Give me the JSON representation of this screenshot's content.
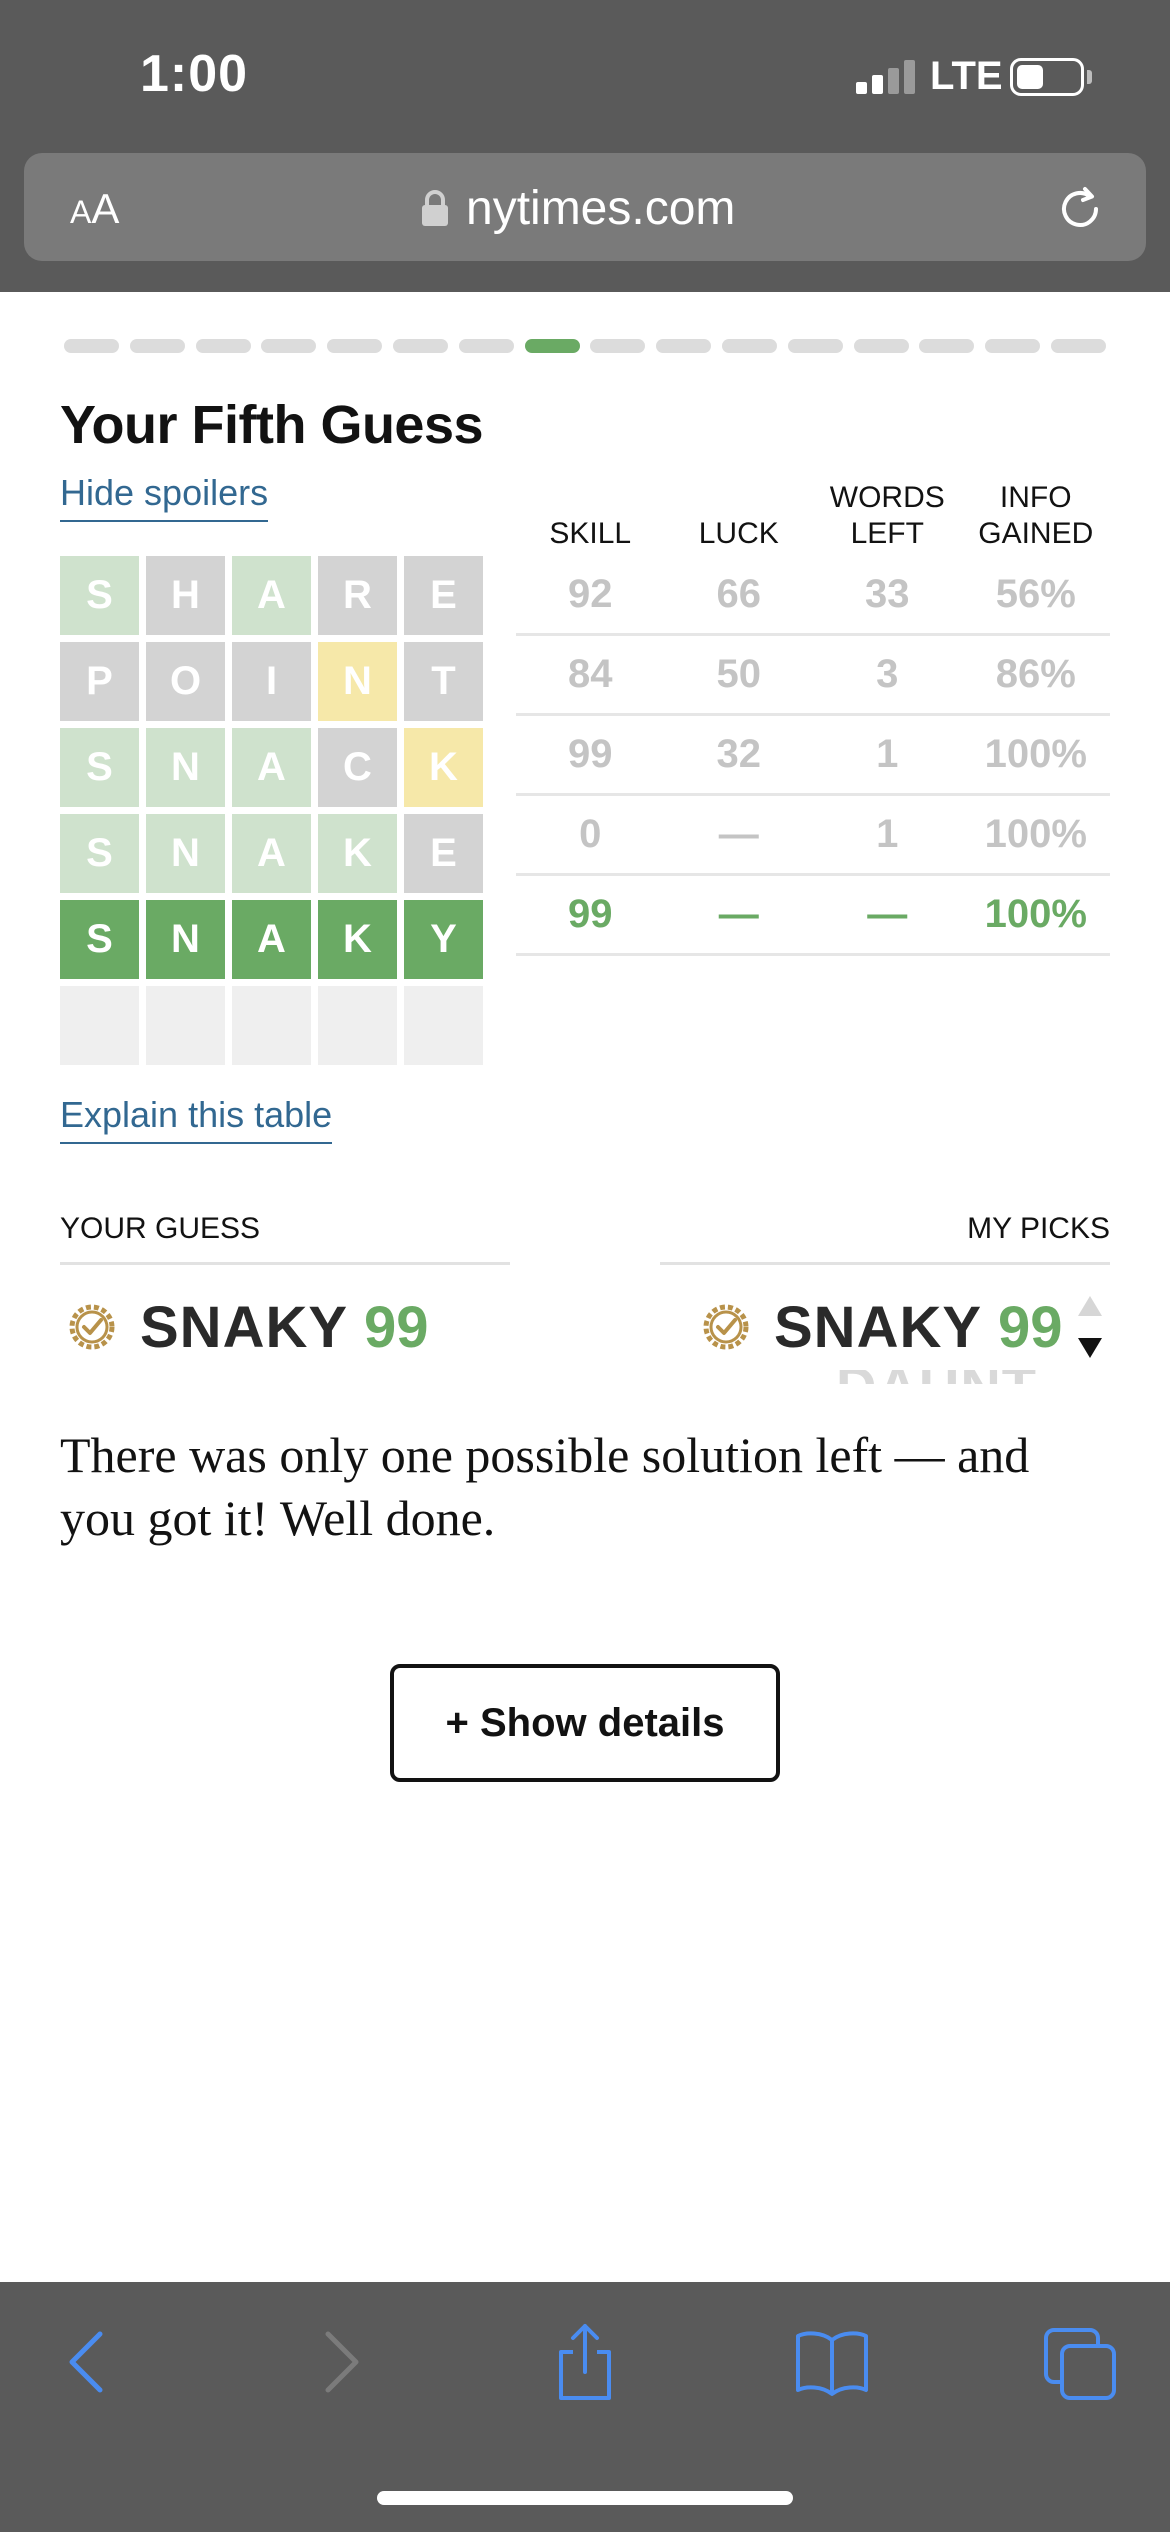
{
  "status_bar": {
    "time": "1:00",
    "network": "LTE",
    "signal_bars_filled": 2,
    "signal_bars_total": 4,
    "battery_level": 0.35
  },
  "browser": {
    "text_size_label_small": "A",
    "text_size_label_large": "A",
    "domain": "nytimes.com"
  },
  "progress": {
    "total": 16,
    "active_index": 7
  },
  "header": {
    "title": "Your Fifth Guess",
    "hide_spoilers": "Hide spoilers"
  },
  "grid": [
    {
      "letters": [
        "S",
        "H",
        "A",
        "R",
        "E"
      ],
      "states": [
        "g-faint",
        "gray",
        "g-faint",
        "gray",
        "gray"
      ]
    },
    {
      "letters": [
        "P",
        "O",
        "I",
        "N",
        "T"
      ],
      "states": [
        "gray",
        "gray",
        "gray",
        "y-faint",
        "gray"
      ]
    },
    {
      "letters": [
        "S",
        "N",
        "A",
        "C",
        "K"
      ],
      "states": [
        "g-faint",
        "g-faint",
        "g-faint",
        "gray",
        "y-faint"
      ]
    },
    {
      "letters": [
        "S",
        "N",
        "A",
        "K",
        "E"
      ],
      "states": [
        "g-faint",
        "g-faint",
        "g-faint",
        "g-faint",
        "gray"
      ]
    },
    {
      "letters": [
        "S",
        "N",
        "A",
        "K",
        "Y"
      ],
      "states": [
        "green",
        "green",
        "green",
        "green",
        "green"
      ]
    },
    {
      "letters": [
        "",
        "",
        "",
        "",
        ""
      ],
      "states": [
        "empty",
        "empty",
        "empty",
        "empty",
        "empty"
      ]
    }
  ],
  "stats": {
    "headers": [
      {
        "line1": "",
        "line2": "SKILL"
      },
      {
        "line1": "",
        "line2": "LUCK"
      },
      {
        "line1": "WORDS",
        "line2": "LEFT"
      },
      {
        "line1": "INFO",
        "line2": "GAINED"
      }
    ],
    "rows": [
      [
        "92",
        "66",
        "33",
        "56%"
      ],
      [
        "84",
        "50",
        "3",
        "86%"
      ],
      [
        "99",
        "32",
        "1",
        "100%"
      ],
      [
        "0",
        "—",
        "1",
        "100%"
      ],
      [
        "99",
        "—",
        "—",
        "100%"
      ]
    ]
  },
  "explain_link": "Explain this table",
  "comparison": {
    "your_guess_label": "YOUR GUESS",
    "my_picks_label": "MY PICKS",
    "your_guess": {
      "word": "SNAKY",
      "score": "99"
    },
    "my_pick": {
      "word": "SNAKY",
      "score": "99"
    },
    "next_pick_partial": "DAUNT"
  },
  "message": "There was only one possible solution left — and you got it! Well done.",
  "show_details_button": "+ Show details",
  "colors": {
    "green": "#6aaa64",
    "link": "#326891",
    "chrome": "#5a5a5a",
    "toolbar_icon": "#4a8cf0"
  }
}
